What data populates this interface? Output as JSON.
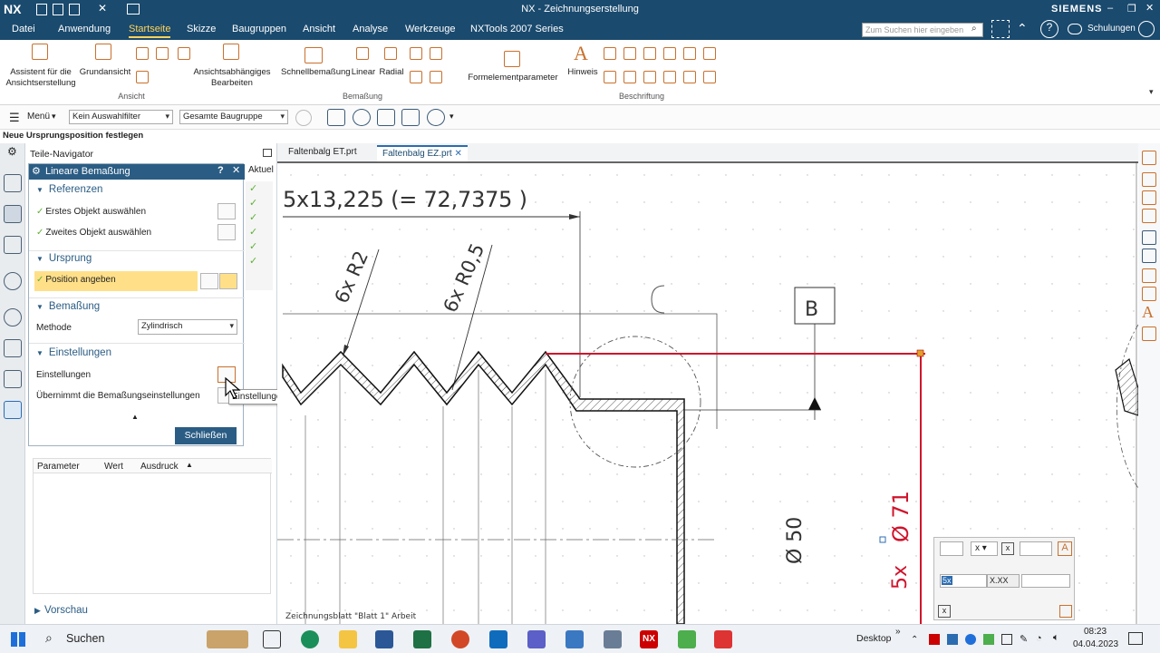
{
  "app": {
    "logo": "NX",
    "title": "NX - Zeichnungserstellung",
    "brand": "SIEMENS"
  },
  "menu": {
    "items": [
      "Datei",
      "Anwendung",
      "Startseite",
      "Skizze",
      "Baugruppen",
      "Ansicht",
      "Analyse",
      "Werkzeuge",
      "NXTools 2007 Series"
    ],
    "active": "Startseite",
    "search_placeholder": "Zum Suchen hier eingeben",
    "training": "Schulungen"
  },
  "ribbon": {
    "labels": {
      "assistant": "Assistent für die Ansichtserstellung",
      "base_view": "Grundansicht",
      "view_dependent": "Ansichtsabhängiges Bearbeiten",
      "rapid_dim": "Schnellbemaßung",
      "linear": "Linear",
      "radial": "Radial",
      "formula": "Formelementparameter",
      "note": "Hinweis"
    },
    "groups": {
      "view": "Ansicht",
      "dim": "Bemaßung",
      "annotation": "Beschriftung"
    }
  },
  "toolbar": {
    "menu": "Menü",
    "filter": "Kein Auswahlfilter",
    "assembly": "Gesamte Baugruppe"
  },
  "status": {
    "prompt": "Neue Ursprungsposition festlegen"
  },
  "navigator": {
    "title": "Teile-Navigator",
    "col_current": "Aktuel"
  },
  "dialog": {
    "title": "Lineare Bemaßung",
    "sections": {
      "references": "Referenzen",
      "origin": "Ursprung",
      "dimension": "Bemaßung",
      "settings": "Einstellungen",
      "preview": "Vorschau"
    },
    "rows": {
      "first": "Erstes Objekt auswählen",
      "second": "Zweites Objekt auswählen",
      "position": "Position angeben",
      "method_label": "Methode",
      "method_value": "Zylindrisch",
      "settings_label": "Einstellungen",
      "inherit": "Übernimmt die Bemaßungseinstellungen",
      "tooltip": "Einstellungen"
    },
    "close_btn": "Schließen"
  },
  "param_table": {
    "headers": [
      "Parameter",
      "Wert",
      "Ausdruck"
    ]
  },
  "tabs": [
    {
      "label": "Faltenbalg ET.prt",
      "active": false
    },
    {
      "label": "Faltenbalg EZ.prt",
      "active": true
    }
  ],
  "drawing": {
    "top_dim": "5x13,225  (=  72,7375  )",
    "r2": "6x  R2",
    "r05": "6x  R0,5",
    "datum": "B",
    "dia50": "Ø 50",
    "dia71": "Ø 71",
    "count": "5x",
    "sheet_label": "Zeichnungsblatt \"Blatt 1\" Arbeit"
  },
  "dim_editor": {
    "text": "5x",
    "format": "X.XX",
    "x_label": "x"
  },
  "taskbar": {
    "search": "Suchen",
    "desktop": "Desktop",
    "time": "08:23",
    "date": "04.04.2023"
  },
  "colors": {
    "accent": "#1a4a6e",
    "highlight": "#ffe089",
    "dim_red": "#d0142c"
  }
}
